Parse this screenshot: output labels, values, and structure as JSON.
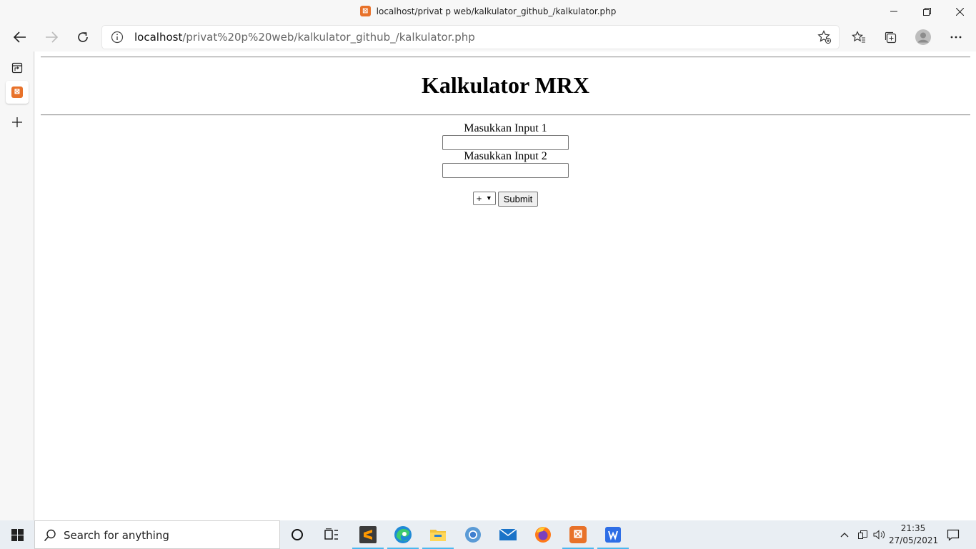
{
  "window": {
    "title": "localhost/privat p web/kalkulator_github_/kalkulator.php",
    "controls": [
      "minimize",
      "restore",
      "close"
    ]
  },
  "toolbar": {
    "url_host": "localhost",
    "url_path": "/privat%20p%20web/kalkulator_github_/kalkulator.php"
  },
  "sidebar": {
    "items": [
      {
        "icon": "tab-actions-icon"
      },
      {
        "icon": "xampp-icon",
        "active": true
      },
      {
        "icon": "plus-icon"
      }
    ]
  },
  "page": {
    "heading": "Kalkulator MRX",
    "input1_label": "Masukkan Input 1",
    "input2_label": "Masukkan Input 2",
    "input1_value": "",
    "input2_value": "",
    "operator_selected": "+",
    "submit_label": "Submit"
  },
  "taskbar": {
    "search_placeholder": "Search for anything",
    "apps": [
      "cortana-icon",
      "task-view-icon",
      "sublime-text-icon",
      "edge-icon",
      "file-explorer-icon",
      "chrome-icon",
      "mail-icon",
      "firefox-icon",
      "xampp-icon",
      "wps-writer-icon"
    ],
    "time": "21:35",
    "date": "27/05/2021"
  },
  "colors": {
    "xampp_orange": "#e8722a",
    "taskbar_accent": "#4cb8ef"
  }
}
